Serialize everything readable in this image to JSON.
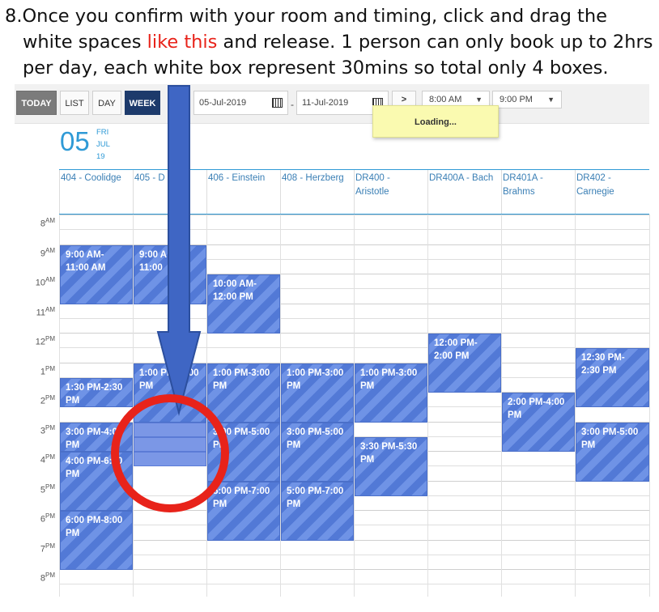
{
  "instructions": {
    "line1": "8.Once you confirm with your room and timing, click and drag the",
    "line2_pre": "white spaces ",
    "line2_red": "like this",
    "line2_post": " and release. 1 person can only book up to 2hrs",
    "line3": "per day, each white box represent 30mins so total only 4 boxes."
  },
  "toolbar": {
    "today_label": "TODAY",
    "list_label": "LIST",
    "day_label": "DAY",
    "week_label": "WEEK",
    "start_date": "05-Jul-2019",
    "end_date": "11-Jul-2019",
    "next_label": ">",
    "start_time": "8:00 AM",
    "end_time": "9:00 PM",
    "loading_text": "Loading..."
  },
  "day_header": {
    "day_number": "05",
    "weekday": "FRI",
    "month": "JUL",
    "year": "19"
  },
  "rooms": [
    {
      "line1": "404 - Coolidge",
      "line2": ""
    },
    {
      "line1": "405 - D",
      "line2": ""
    },
    {
      "line1": "406 - Einstein",
      "line2": ""
    },
    {
      "line1": "408 - Herzberg",
      "line2": ""
    },
    {
      "line1": "DR400 -",
      "line2": "Aristotle"
    },
    {
      "line1": "DR400A - Bach",
      "line2": ""
    },
    {
      "line1": "DR401A -",
      "line2": "Brahms"
    },
    {
      "line1": "DR402 -",
      "line2": "Carnegie"
    }
  ],
  "times": [
    {
      "num": "8",
      "ap": "AM"
    },
    {
      "num": "9",
      "ap": "AM"
    },
    {
      "num": "10",
      "ap": "AM"
    },
    {
      "num": "11",
      "ap": "AM"
    },
    {
      "num": "12",
      "ap": "PM"
    },
    {
      "num": "1",
      "ap": "PM"
    },
    {
      "num": "2",
      "ap": "PM"
    },
    {
      "num": "3",
      "ap": "PM"
    },
    {
      "num": "4",
      "ap": "PM"
    },
    {
      "num": "5",
      "ap": "PM"
    },
    {
      "num": "6",
      "ap": "PM"
    },
    {
      "num": "7",
      "ap": "PM"
    },
    {
      "num": "8",
      "ap": "PM"
    }
  ],
  "events": [
    {
      "col": 0,
      "start": 9.0,
      "end": 11.0,
      "label": "9:00 AM-\n11:00 AM"
    },
    {
      "col": 1,
      "start": 9.0,
      "end": 11.0,
      "label": "9:00 A\n11:00 "
    },
    {
      "col": 2,
      "start": 10.0,
      "end": 12.0,
      "label": "10:00 AM-\n12:00 PM"
    },
    {
      "col": 5,
      "start": 12.0,
      "end": 14.0,
      "label": "12:00 PM-\n2:00 PM"
    },
    {
      "col": 7,
      "start": 12.5,
      "end": 14.5,
      "label": "12:30 PM-\n2:30 PM"
    },
    {
      "col": 1,
      "start": 13.0,
      "end": 15.0,
      "label": "1:00 PM-   :00\nPM"
    },
    {
      "col": 2,
      "start": 13.0,
      "end": 15.0,
      "label": "1:00 PM-3:00\nPM"
    },
    {
      "col": 3,
      "start": 13.0,
      "end": 15.0,
      "label": "1:00 PM-3:00\nPM"
    },
    {
      "col": 4,
      "start": 13.0,
      "end": 15.0,
      "label": "1:00 PM-3:00\nPM"
    },
    {
      "col": 0,
      "start": 13.5,
      "end": 14.5,
      "label": "1:30 PM-2:30\nPM"
    },
    {
      "col": 6,
      "start": 14.0,
      "end": 16.0,
      "label": "2:00 PM-4:00\nPM"
    },
    {
      "col": 0,
      "start": 15.0,
      "end": 16.0,
      "label": "3:00 PM-4:0\nPM"
    },
    {
      "col": 2,
      "start": 15.0,
      "end": 17.0,
      "label": "3:00 PM-5:00\nPM"
    },
    {
      "col": 3,
      "start": 15.0,
      "end": 17.0,
      "label": "3:00 PM-5:00\nPM"
    },
    {
      "col": 7,
      "start": 15.0,
      "end": 17.0,
      "label": "3:00 PM-5:00\nPM"
    },
    {
      "col": 4,
      "start": 15.5,
      "end": 17.5,
      "label": "3:30 PM-5:30\nPM"
    },
    {
      "col": 0,
      "start": 16.0,
      "end": 18.0,
      "label": "4:00 PM-6:00\nPM"
    },
    {
      "col": 2,
      "start": 17.0,
      "end": 19.0,
      "label": "5:00 PM-7:00\nPM"
    },
    {
      "col": 3,
      "start": 17.0,
      "end": 19.0,
      "label": "5:00 PM-7:00\nPM"
    },
    {
      "col": 0,
      "start": 18.0,
      "end": 20.0,
      "label": "6:00 PM-8:00\nPM"
    }
  ],
  "selection": {
    "col": 1,
    "start": 15.0,
    "end": 17.0
  },
  "colors": {
    "event_fill": "#5279d6",
    "selection_fill": "#7b97e6",
    "arrow": "#3f66c4",
    "circle": "#e8231a",
    "accent": "#2f9ad6",
    "week_button": "#1d3a6b"
  },
  "annotations": {
    "arrow": "down-arrow",
    "circle": "red-highlight-circle"
  }
}
